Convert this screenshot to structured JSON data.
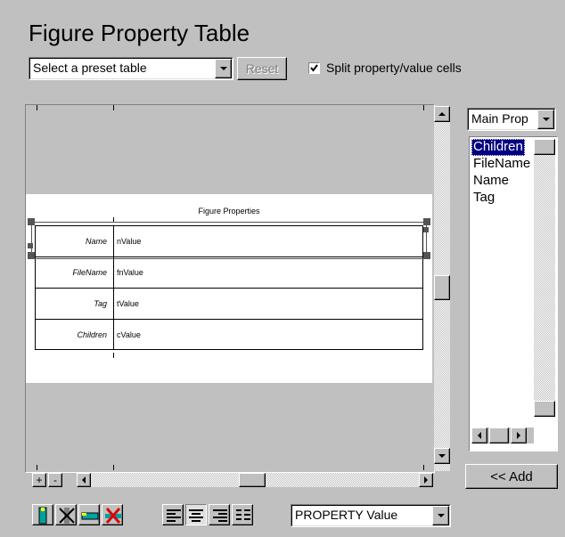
{
  "title": "Figure Property Table",
  "preset": {
    "selected": "Select a preset table",
    "reset_label": "Reset"
  },
  "split_checkbox": {
    "label": "Split property/value cells",
    "checked": true
  },
  "table": {
    "caption": "Figure Properties",
    "rows": [
      {
        "label": "Name",
        "value": "nValue"
      },
      {
        "label": "FileName",
        "value": "fnValue"
      },
      {
        "label": "Tag",
        "value": "tValue"
      },
      {
        "label": "Children",
        "value": "cValue"
      }
    ]
  },
  "zoom": {
    "plus": "+",
    "minus": "-"
  },
  "property_filter": {
    "selected": "Main Prop"
  },
  "property_list": {
    "items": [
      "Children",
      "FileName",
      "Name",
      "Tag"
    ],
    "selected_index": 0
  },
  "add_button": {
    "label": "<< Add"
  },
  "format_select": {
    "selected": "PROPERTY Value"
  },
  "colors": {
    "selection": "#000080",
    "background": "#c0c0c0"
  }
}
